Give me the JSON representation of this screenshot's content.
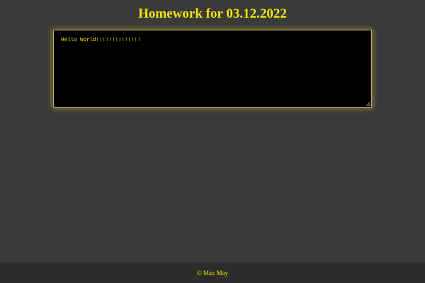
{
  "header": {
    "title": "Homework for 03.12.2022"
  },
  "editor": {
    "value": "Hello World!!!!!!!!!!!!!!"
  },
  "footer": {
    "text": "© Max May"
  },
  "colors": {
    "background": "#3a3a3a",
    "footer_background": "#2c2c2c",
    "accent": "#f2e600",
    "editor_background": "#000000"
  }
}
